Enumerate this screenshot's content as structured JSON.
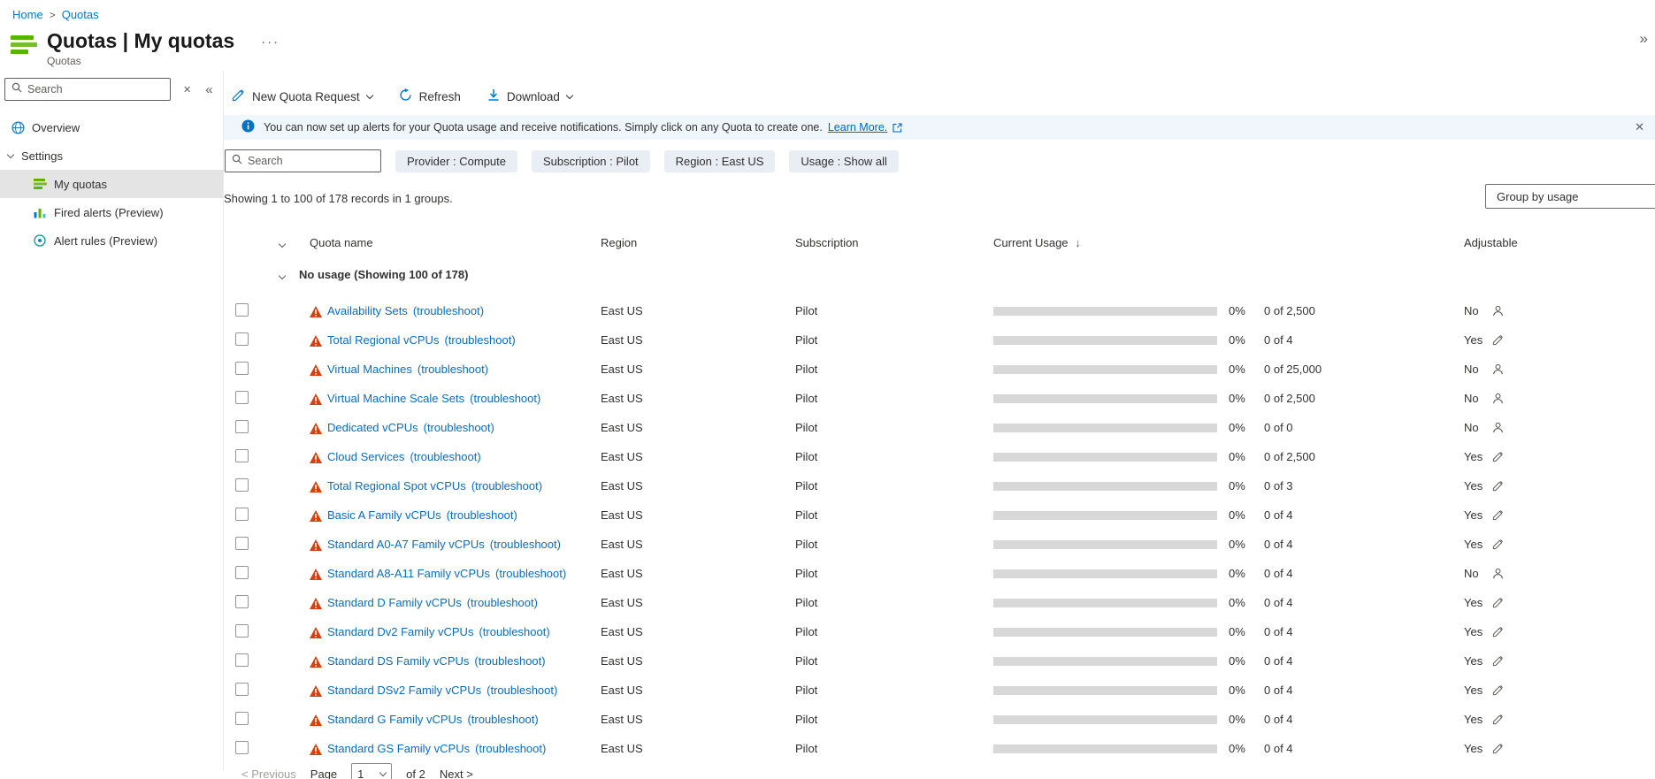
{
  "colors": {
    "accent": "#0078d4",
    "warning": "#d6410f",
    "quotas_icon_green": "#5db300",
    "banner_bg": "#eff6fc",
    "selected_bg": "#e4e4e4"
  },
  "breadcrumb": {
    "home": "Home",
    "separator": ">",
    "current": "Quotas"
  },
  "header": {
    "title": "Quotas | My quotas",
    "subtitle": "Quotas",
    "more_label": "···",
    "expand_label": "»"
  },
  "sidebar": {
    "search": {
      "placeholder": "Search"
    },
    "clear_label": "✕",
    "collapse_label": "«",
    "items": [
      {
        "label": "Overview"
      },
      {
        "label": "Settings"
      },
      {
        "label": "My quotas"
      },
      {
        "label": "Fired alerts (Preview)"
      },
      {
        "label": "Alert rules (Preview)"
      }
    ]
  },
  "toolbar": {
    "new_quota_request": "New Quota Request",
    "refresh": "Refresh",
    "download": "Download"
  },
  "banner": {
    "message": "You can now set up alerts for your Quota usage and receive notifications. Simply click on any Quota to create one.",
    "link_label": "Learn More.",
    "close_label": "✕"
  },
  "filters": {
    "search_placeholder": "Search",
    "pills": [
      "Provider : Compute",
      "Subscription : Pilot",
      "Region : East US",
      "Usage : Show all"
    ]
  },
  "summary": "Showing 1 to 100 of 178 records in 1 groups.",
  "group_by_label": "Group by usage",
  "table": {
    "columns": {
      "quota_name": "Quota name",
      "region": "Region",
      "subscription": "Subscription",
      "current_usage": "Current Usage",
      "sort_indicator": "↓",
      "adjustable": "Adjustable"
    },
    "group_header": "No usage (Showing 100 of 178)",
    "troubleshoot": "(troubleshoot)",
    "rows": [
      {
        "name": "Availability Sets",
        "region": "East US",
        "subscription": "Pilot",
        "percent": "0%",
        "usage": "0 of 2,500",
        "adjustable": "No",
        "icon": "support-request-icon"
      },
      {
        "name": "Total Regional vCPUs",
        "region": "East US",
        "subscription": "Pilot",
        "percent": "0%",
        "usage": "0 of 4",
        "adjustable": "Yes",
        "icon": "pencil-edit-icon"
      },
      {
        "name": "Virtual Machines",
        "region": "East US",
        "subscription": "Pilot",
        "percent": "0%",
        "usage": "0 of 25,000",
        "adjustable": "No",
        "icon": "support-request-icon"
      },
      {
        "name": "Virtual Machine Scale Sets",
        "region": "East US",
        "subscription": "Pilot",
        "percent": "0%",
        "usage": "0 of 2,500",
        "adjustable": "No",
        "icon": "support-request-icon"
      },
      {
        "name": "Dedicated vCPUs",
        "region": "East US",
        "subscription": "Pilot",
        "percent": "0%",
        "usage": "0 of 0",
        "adjustable": "No",
        "icon": "support-request-icon"
      },
      {
        "name": "Cloud Services",
        "region": "East US",
        "subscription": "Pilot",
        "percent": "0%",
        "usage": "0 of 2,500",
        "adjustable": "Yes",
        "icon": "pencil-edit-icon"
      },
      {
        "name": "Total Regional Spot vCPUs",
        "region": "East US",
        "subscription": "Pilot",
        "percent": "0%",
        "usage": "0 of 3",
        "adjustable": "Yes",
        "icon": "pencil-edit-icon"
      },
      {
        "name": "Basic A Family vCPUs",
        "region": "East US",
        "subscription": "Pilot",
        "percent": "0%",
        "usage": "0 of 4",
        "adjustable": "Yes",
        "icon": "pencil-edit-icon"
      },
      {
        "name": "Standard A0-A7 Family vCPUs",
        "region": "East US",
        "subscription": "Pilot",
        "percent": "0%",
        "usage": "0 of 4",
        "adjustable": "Yes",
        "icon": "pencil-edit-icon"
      },
      {
        "name": "Standard A8-A11 Family vCPUs",
        "region": "East US",
        "subscription": "Pilot",
        "percent": "0%",
        "usage": "0 of 4",
        "adjustable": "No",
        "icon": "support-request-icon"
      },
      {
        "name": "Standard D Family vCPUs",
        "region": "East US",
        "subscription": "Pilot",
        "percent": "0%",
        "usage": "0 of 4",
        "adjustable": "Yes",
        "icon": "pencil-edit-icon"
      },
      {
        "name": "Standard Dv2 Family vCPUs",
        "region": "East US",
        "subscription": "Pilot",
        "percent": "0%",
        "usage": "0 of 4",
        "adjustable": "Yes",
        "icon": "pencil-edit-icon"
      },
      {
        "name": "Standard DS Family vCPUs",
        "region": "East US",
        "subscription": "Pilot",
        "percent": "0%",
        "usage": "0 of 4",
        "adjustable": "Yes",
        "icon": "pencil-edit-icon"
      },
      {
        "name": "Standard DSv2 Family vCPUs",
        "region": "East US",
        "subscription": "Pilot",
        "percent": "0%",
        "usage": "0 of 4",
        "adjustable": "Yes",
        "icon": "pencil-edit-icon"
      },
      {
        "name": "Standard G Family vCPUs",
        "region": "East US",
        "subscription": "Pilot",
        "percent": "0%",
        "usage": "0 of 4",
        "adjustable": "Yes",
        "icon": "pencil-edit-icon"
      },
      {
        "name": "Standard GS Family vCPUs",
        "region": "East US",
        "subscription": "Pilot",
        "percent": "0%",
        "usage": "0 of 4",
        "adjustable": "Yes",
        "icon": "pencil-edit-icon"
      }
    ]
  },
  "pagination": {
    "previous": "< Previous",
    "page": "Page",
    "current_page": "1",
    "of": "of 2",
    "next": "Next >"
  }
}
